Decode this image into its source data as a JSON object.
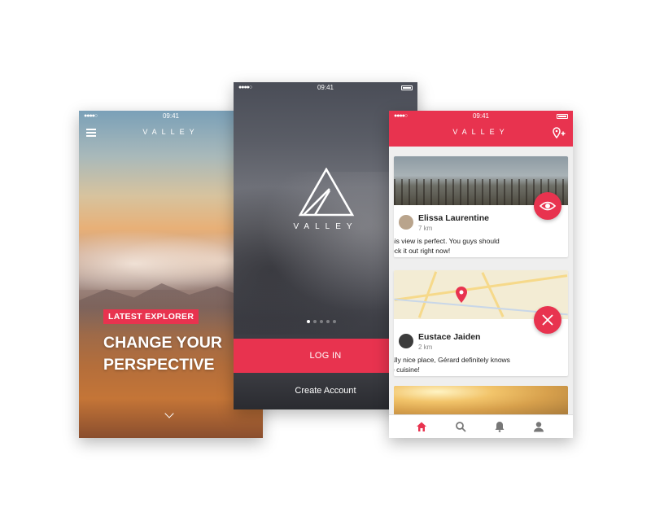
{
  "status": {
    "time": "09:41"
  },
  "brand": {
    "name": "VALLEY",
    "accent": "#e8334f"
  },
  "left_screen": {
    "menu_icon": "hamburger-icon",
    "badge": "LATEST EXPLORER",
    "headline": "CHANGE YOUR PERSPECTIVE",
    "scroll_icon": "chevron-down-icon"
  },
  "middle_screen": {
    "logo_icon": "valley-triangle-logo",
    "pager": {
      "count": 5,
      "active": 1
    },
    "login_label": "LOG IN",
    "create_label": "Create Account"
  },
  "right_screen": {
    "add_location_icon": "pin-plus-icon",
    "posts": [
      {
        "user": "Elissa Laurentine",
        "distance": "7 km",
        "comment": "his view is perfect. You guys should\neck it out right now!",
        "action_icon": "eye-icon"
      },
      {
        "user": "Eustace Jaiden",
        "distance": "2 km",
        "comment": "ally nice place, Gérard definitely knows\ne cuisine!",
        "action_icon": "fork-knife-icon"
      }
    ],
    "tabs": [
      {
        "name": "home-icon",
        "active": true
      },
      {
        "name": "search-icon",
        "active": false
      },
      {
        "name": "bell-icon",
        "active": false
      },
      {
        "name": "profile-icon",
        "active": false
      }
    ]
  }
}
